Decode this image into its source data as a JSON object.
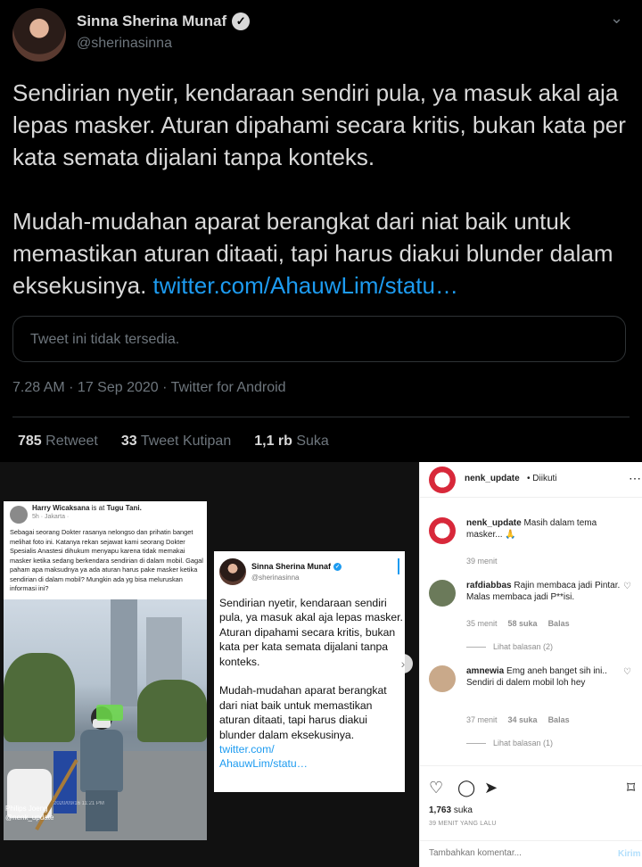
{
  "twitter": {
    "name": "Sinna Sherina Munaf",
    "handle": "@sherinasinna",
    "text_part1": "Sendirian nyetir, kendaraan sendiri pula, ya masuk akal aja lepas masker. Aturan dipahami secara kritis, bukan kata per kata semata dijalani tanpa konteks.\n\nMudah-mudahan aparat berangkat dari niat baik untuk memastikan aturan ditaati, tapi harus diakui blunder dalam eksekusinya. ",
    "link": "twitter.com/AhauwLim/statu…",
    "unavailable": "Tweet ini tidak tersedia.",
    "meta": "7.28 AM · 17 Sep 2020 · Twitter for Android",
    "stats": {
      "retweet_count": "785",
      "retweet_label": "Retweet",
      "quote_count": "33",
      "quote_label": "Tweet Kutipan",
      "like_count": "1,1 rb",
      "like_label": "Suka"
    }
  },
  "instagram": {
    "post_image": {
      "fb_post": {
        "name": "Harry Wicaksana",
        "location_prefix": "is at",
        "location": "Tugu Tani.",
        "time": "5h · Jakarta ·",
        "text": "Sebagai seorang Dokter rasanya nelongso dan prihatin banget melihat foto ini. Katanya rekan sejawat kami seorang Dokter Spesialis Anastesi dihukum menyapu karena tidak memakai masker ketika sedang berkendara sendirian di dalam mobil. Gagal paham apa maksudnya ya ada aturan harus pake masker ketika sendirian di dalam mobil? Mungkin ada yg bisa meluruskan informasi ini?"
      },
      "watermark_1": "Philips Joeng",
      "watermark_2": "@nenk_update",
      "watermark_date": "2020/09/16 11:21 PM",
      "tweet_card": {
        "name": "Sinna Sherina Munaf",
        "handle": "@sherinasinna",
        "text": "Sendirian nyetir, kendaraan sendiri pula, ya masuk akal aja lepas masker. Aturan dipahami secara kritis, bukan kata per kata semata dijalani tanpa konteks.\n\nMudah-mudahan aparat berangkat dari niat baik untuk memastikan aturan ditaati, tapi harus diakui blunder dalam eksekusinya. ",
        "link": "twitter.com/\nAhauwLim/statu…"
      }
    },
    "header": {
      "username": "nenk_update",
      "follow_status": "• Diikuti"
    },
    "caption": {
      "username": "nenk_update",
      "text": "Masih dalam tema masker... 🙏",
      "time": "39 menit"
    },
    "comments": [
      {
        "username": "rafdiabbas",
        "text": "Rajin membaca jadi Pintar. Malas membaca jadi P**isi.",
        "time": "35 menit",
        "likes": "58 suka",
        "reply": "Balas",
        "view_replies": "Lihat balasan (2)"
      },
      {
        "username": "amnewia",
        "text": "Emg aneh banget sih ini.. Sendiri di dalem mobil loh hey",
        "time": "37 menit",
        "likes": "34 suka",
        "reply": "Balas",
        "view_replies": "Lihat balasan (1)"
      }
    ],
    "likes_count": "1,763",
    "likes_label": "suka",
    "posted_ago": "39 MENIT YANG LALU",
    "comment_placeholder": "Tambahkan komentar...",
    "post_button": "Kirim"
  }
}
